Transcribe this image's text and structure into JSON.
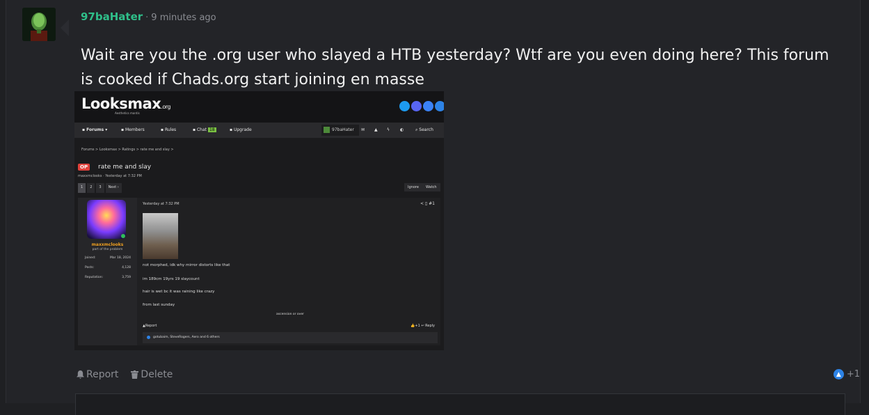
{
  "post": {
    "username": "97baHater",
    "separator": "·",
    "timestamp": "9 minutes ago",
    "message": "Wait are you the .org user who slayed a HTB yesterday? Wtf are you even doing here? This forum is cooked if Chads.org start joining en masse"
  },
  "embed": {
    "logo_main": "Looksmax",
    "logo_suffix": ".org",
    "logo_sub": "Aesthetics mantis",
    "nav": {
      "forums": "Forums",
      "members": "Members",
      "rules": "Rules",
      "chat": "Chat",
      "upgrade": "Upgrade",
      "user": "97baHater",
      "search": "Search"
    },
    "breadcrumb": "Forums > Looksmax > Ratings > rate me and slay >",
    "op_badge": "OP",
    "thread_title": "rate me and slay",
    "thread_meta": "maxxmclooks · Yesterday at 7:32 PM",
    "pages": [
      "1",
      "2",
      "3",
      "Next ›"
    ],
    "ignore": "Ignore",
    "watch": "Watch",
    "poster": {
      "name": "maxxmclooks",
      "title": "part of the problem",
      "joined_label": "Joined:",
      "joined": "Mar 18, 2024",
      "posts_label": "Posts:",
      "posts": "4,128",
      "rep_label": "Reputation:",
      "rep": "3,759"
    },
    "post_date": "Yesterday at 7:32 PM",
    "post_num": "#1",
    "lines": [
      "not morphed, idk why mirror distorts like that",
      "im 189cm 19yrs 19 slaycount",
      "hair is wet bc it was raining like crazy",
      "from last sunday"
    ],
    "ascension": "ascension or over",
    "report": "Report",
    "likes": "+1",
    "reply": "Reply",
    "reactions": "gotubaim, SteveRogers, Aero and 6 others"
  },
  "actions": {
    "report": "Report",
    "delete": "Delete",
    "like_count": "+1"
  }
}
